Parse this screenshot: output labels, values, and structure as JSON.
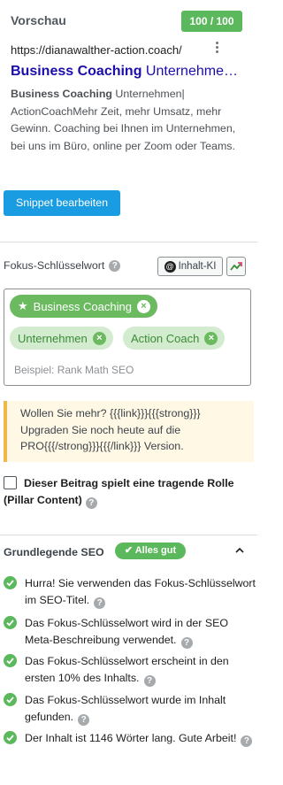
{
  "preview": {
    "title": "Vorschau",
    "score": "100 / 100",
    "url": "https://dianawalther-action.coach/",
    "link_bold": "Business Coaching",
    "link_rest": " Unternehmen…",
    "desc_bold": "Business Coaching",
    "desc_rest": " Unternehmen| ActionCoachMehr Zeit, mehr Umsatz, mehr Gewinn. Coaching bei Ihnen im Unternehmen, bei uns im Büro, online per Zoom oder Teams.",
    "edit_button": "Snippet bearbeiten"
  },
  "focus_keyword": {
    "label": "Fokus-Schlüsselwort",
    "ai_button": "Inhalt-KI",
    "tags": [
      {
        "label": "Business Coaching",
        "primary": true
      },
      {
        "label": "Unternehmen",
        "primary": false
      },
      {
        "label": "Action Coach",
        "primary": false
      }
    ],
    "placeholder": "Beispiel: Rank Math SEO"
  },
  "notice": {
    "text": "Wollen Sie mehr? {{{link}}}{{{strong}}} Upgraden Sie noch heute auf die PRO{{{/strong}}}{{{/link}}} Version."
  },
  "pillar": {
    "label": "Dieser Beitrag spielt eine tragende Rolle (Pillar Content)"
  },
  "basic_seo": {
    "title": "Grundlegende SEO",
    "badge": "✔ Alles gut",
    "checks": [
      "Hurra! Sie verwenden das Fokus-Schlüsselwort im SEO-Titel.",
      "Das Fokus-Schlüsselwort wird in der SEO Meta-Beschreibung verwendet.",
      "Das Fokus-Schlüsselwort erscheint in den ersten 10% des Inhalts.",
      "Das Fokus-Schlüsselwort wurde im Inhalt gefunden.",
      "Der Inhalt ist 1146 Wörter lang. Gute Arbeit!"
    ]
  },
  "icons": {
    "help": "question-circle-icon",
    "check": "check-circle-icon",
    "star": "star-icon",
    "remove": "close-circle-icon",
    "trend": "trend-chart-icon",
    "collapse": "chevron-up-icon",
    "more": "more-vertical-icon"
  },
  "colors": {
    "accent": "#1a9ce2",
    "success": "#5cb85c",
    "link": "#1a0dab",
    "notice_border": "#f0b849"
  }
}
